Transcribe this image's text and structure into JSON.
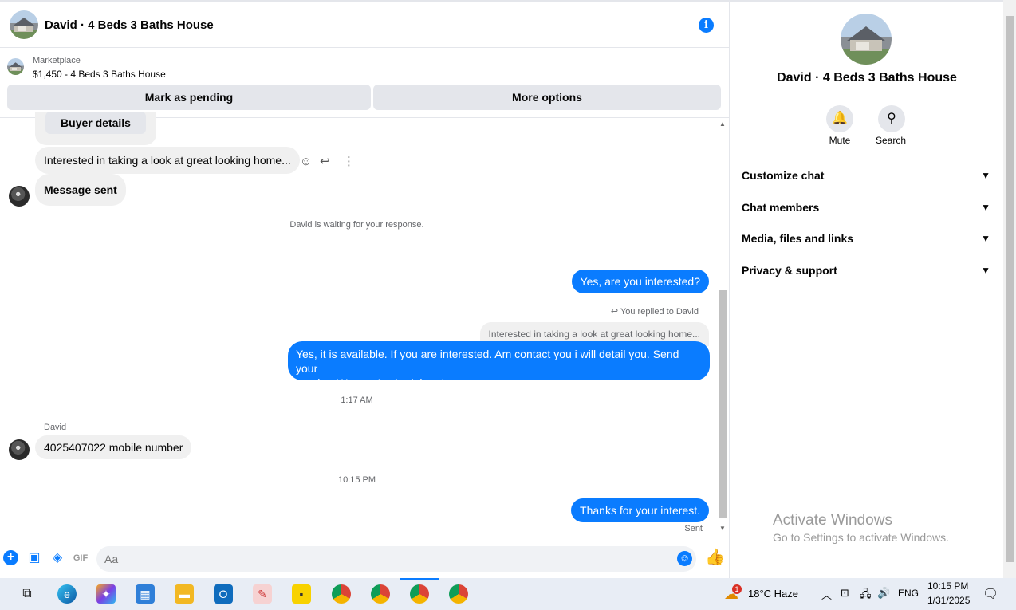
{
  "header": {
    "title": "David · 4 Beds 3 Baths House"
  },
  "listing": {
    "label": "Marketplace",
    "price_title": "$1,450 - 4 Beds 3 Baths House",
    "mark_pending": "Mark as pending",
    "more_options": "More options"
  },
  "messages": {
    "buyer_details": "Buyer details",
    "interested_preview": "Interested in taking a look at great looking home...",
    "message_sent": "Message sent",
    "waiting": "David is waiting for your response.",
    "out1": "Yes, are you interested?",
    "replied_to": "You replied to David",
    "quoted": "Interested in taking a look at great looking home...",
    "out2_line1": "Yes, it is available. If you are interested. Am contact you i will detail you. Send your",
    "out2_line2": "numbar We can I schedule a tour.",
    "time1": "1:17 AM",
    "sender_name": "David",
    "in_number": "4025407022 mobile number",
    "time2": "10:15 PM",
    "out3": "Thanks for your interest.",
    "sent_status": "Sent"
  },
  "composer": {
    "placeholder": "Aa"
  },
  "side": {
    "name": "David · 4 Beds 3 Baths House",
    "mute": "Mute",
    "search": "Search",
    "menu": [
      "Customize chat",
      "Chat members",
      "Media, files and links",
      "Privacy & support"
    ]
  },
  "watermark": {
    "line1": "Activate Windows",
    "line2": "Go to Settings to activate Windows."
  },
  "taskbar": {
    "weather_badge": "1",
    "weather": "18°C  Haze",
    "lang": "ENG",
    "time": "10:15 PM",
    "date": "1/31/2025"
  },
  "colors": {
    "accent": "#0a7cff",
    "bubble_in": "#f0f0f0",
    "divider": "#e4e6eb"
  }
}
